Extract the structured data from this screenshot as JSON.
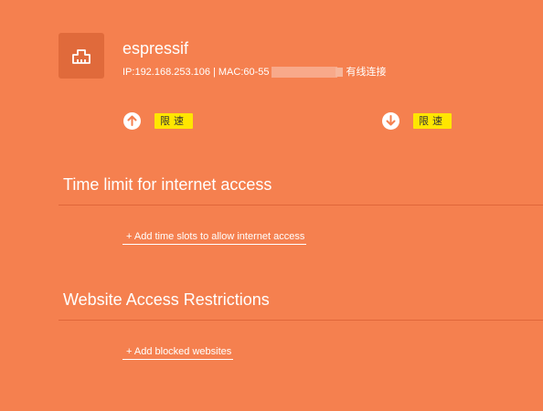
{
  "device": {
    "icon": "ethernet-port-icon",
    "name": "espressif",
    "ip_label": "IP:192.168.253.106",
    "separator": "|",
    "mac_label": "MAC:60-55",
    "connection_type": "有线连接"
  },
  "speed": {
    "upload_icon": "arrow-up-circle-icon",
    "upload_limit_label": "限速",
    "download_icon": "arrow-down-circle-icon",
    "download_limit_label": "限速"
  },
  "time_limit": {
    "title": "Time limit for internet access",
    "add_link": "+ Add time slots to allow internet access"
  },
  "website_restrictions": {
    "title": "Website Access Restrictions",
    "add_link": "+ Add blocked websites"
  },
  "colors": {
    "background": "#f5804f",
    "icon_box": "#e06a3b",
    "badge": "#ffe600",
    "divider": "#e0663a"
  }
}
